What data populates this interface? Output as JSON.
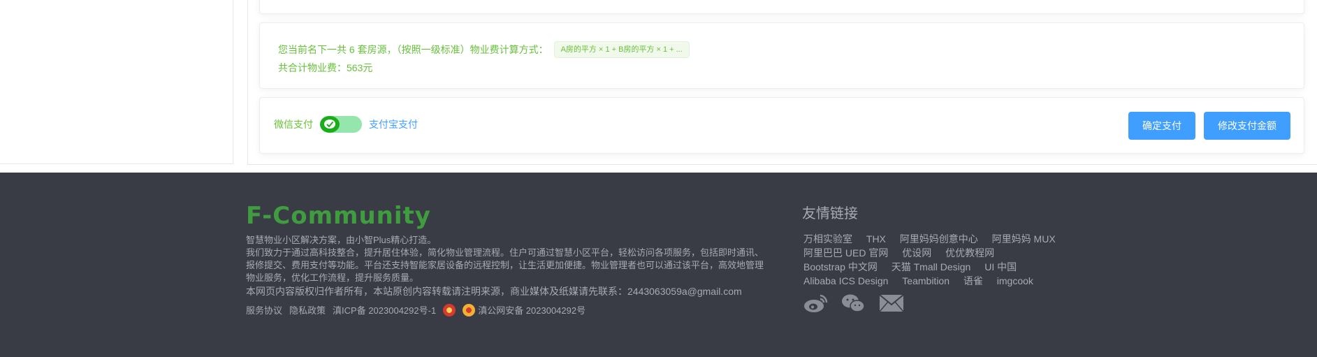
{
  "billing": {
    "info_line1": "您当前名下一共 6 套房源，（按照一级标准）物业费计算方式：",
    "formula": "A房的平方 × 1 + B房的平方 × 1 + ...",
    "info_line2": "共合计物业费：563元"
  },
  "payment": {
    "wechat_label": "微信支付",
    "alipay_label": "支付宝支付",
    "confirm_label": "确定支付",
    "modify_label": "修改支付金额"
  },
  "footer": {
    "logo": "F-Community",
    "desc_line1": "智慧物业小区解决方案，由小智Plus精心打造。",
    "desc_body": "我们致力于通过高科技整合，提升居住体验，简化物业管理流程。住户可通过智慧小区平台，轻松访问各项服务，包括即时通讯、报修提交、费用支付等功能。平台还支持智能家居设备的远程控制，让生活更加便捷。物业管理者也可以通过该平台，高效地管理物业服务，优化工作流程，提升服务质量。",
    "copyright": "本网页内容版权归作者所有，本站原创内容转载请注明来源，商业媒体及纸媒请先联系：2443063059a@gmail.com",
    "service_agreement": "服务协议",
    "privacy_policy": "隐私政策",
    "icp": "滇ICP备 2023004292号-1",
    "police": "滇公网安备 2023004292号",
    "friends_title": "友情链接",
    "friend_links": [
      "万相实验室",
      "THX",
      "阿里妈妈创意中心",
      "阿里妈妈 MUX",
      "阿里巴巴 UED 官网",
      "优设网",
      "优优教程网",
      "Bootstrap 中文网",
      "天猫 Tmall Design",
      "UI 中国",
      "Alibaba ICS Design",
      "Teambition",
      "语雀",
      "imgcook"
    ],
    "social_icons": [
      "weibo-icon",
      "wechat-icon",
      "mail-icon"
    ]
  },
  "colors": {
    "accent_green": "#67c23a",
    "primary_blue": "#409eff",
    "footer_bg": "#393b45",
    "logo_green": "#3f9d3f"
  }
}
